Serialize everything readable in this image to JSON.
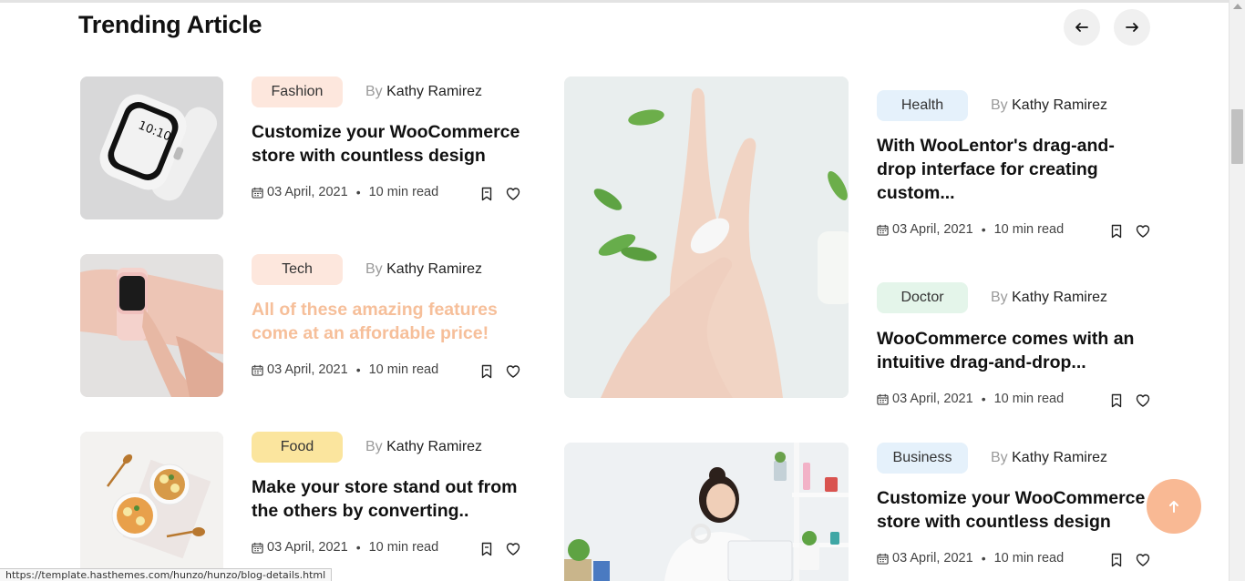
{
  "section": {
    "title": "Trending Article"
  },
  "nav": {
    "prev_icon": "arrow-left-icon",
    "next_icon": "arrow-right-icon"
  },
  "articles": [
    {
      "tag": "Fashion",
      "tag_color": "#fde7dd",
      "by": "By",
      "author": "Kathy Ramirez",
      "title": "Customize your WooCommerce store with countless design",
      "date": "03 April, 2021",
      "read": "10 min read",
      "image": "smartwatch-image"
    },
    {
      "tag": "Tech",
      "tag_color": "#fde7dd",
      "by": "By",
      "author": "Kathy Ramirez",
      "title": "All of these amazing features come at an affordable price!",
      "date": "03 April, 2021",
      "read": "10 min read",
      "image": "wrist-watch-image"
    },
    {
      "tag": "Food",
      "tag_color": "#fbe59e",
      "by": "By",
      "author": "Kathy Ramirez",
      "title": "Make your store stand out from the others by converting..",
      "date": "03 April, 2021",
      "read": "10 min read",
      "image": "food-bowls-image"
    },
    {
      "tag": "Health",
      "tag_color": "#e5f1fb",
      "by": "By",
      "author": "Kathy Ramirez",
      "title": "With WooLentor's drag-and-drop interface for creating custom...",
      "date": "03 April, 2021",
      "read": "10 min read",
      "image": "hand-cream-image"
    },
    {
      "tag": "Doctor",
      "tag_color": "#e4f5ea",
      "by": "By",
      "author": "Kathy Ramirez",
      "title": "WooCommerce comes with an intuitive drag-and-drop...",
      "date": "03 April, 2021",
      "read": "10 min read"
    },
    {
      "tag": "Business",
      "tag_color": "#e5f1fb",
      "by": "By",
      "author": "Kathy Ramirez",
      "title": "Customize your WooCommerce store with countless design",
      "date": "03 April, 2021",
      "read": "10 min read",
      "image": "woman-laptop-image"
    }
  ],
  "colors": {
    "accent": "#f9b994",
    "highlight_title": "#f6bf9a"
  },
  "status_bar": {
    "url": "https://template.hasthemes.com/hunzo/hunzo/blog-details.html"
  }
}
